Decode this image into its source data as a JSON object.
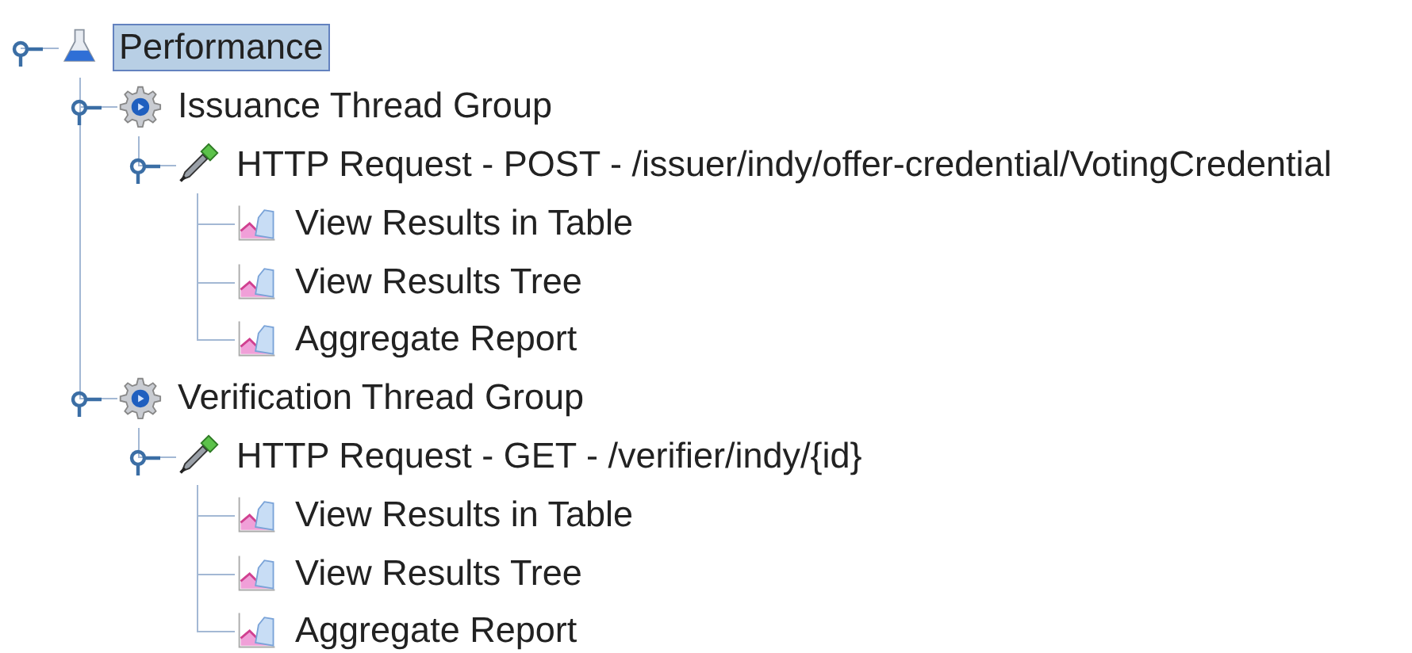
{
  "tree": [
    {
      "label": "Performance",
      "kind": "test-plan",
      "expanded": true,
      "selected": true,
      "children": [
        {
          "label": "Issuance Thread Group",
          "kind": "thread-group",
          "expanded": true,
          "selected": false,
          "children": [
            {
              "label": "HTTP Request - POST - /issuer/indy/offer-credential/VotingCredential",
              "kind": "sampler",
              "expanded": true,
              "selected": false,
              "children": [
                {
                  "label": "View Results in Table",
                  "kind": "listener",
                  "selected": false
                },
                {
                  "label": "View Results Tree",
                  "kind": "listener",
                  "selected": false
                },
                {
                  "label": "Aggregate Report",
                  "kind": "listener",
                  "selected": false
                }
              ]
            }
          ]
        },
        {
          "label": "Verification Thread Group",
          "kind": "thread-group",
          "expanded": true,
          "selected": false,
          "children": [
            {
              "label": "HTTP Request - GET - /verifier/indy/{id}",
              "kind": "sampler",
              "expanded": true,
              "selected": false,
              "children": [
                {
                  "label": "View Results in Table",
                  "kind": "listener",
                  "selected": false
                },
                {
                  "label": "View Results Tree",
                  "kind": "listener",
                  "selected": false
                },
                {
                  "label": "Aggregate Report",
                  "kind": "listener",
                  "selected": false
                }
              ]
            }
          ]
        }
      ]
    }
  ]
}
